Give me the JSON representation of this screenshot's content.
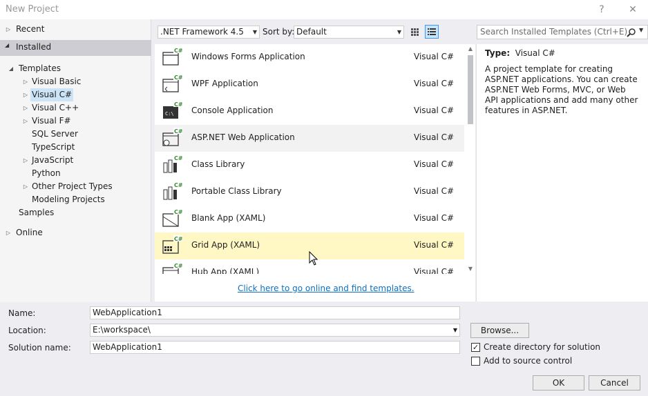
{
  "window": {
    "title": "New Project",
    "help_glyph": "?",
    "close_glyph": "✕"
  },
  "nav": {
    "recent": "Recent",
    "installed": "Installed",
    "templates": "Templates",
    "items": [
      {
        "label": "Visual Basic",
        "expandable": true
      },
      {
        "label": "Visual C#",
        "expandable": true,
        "selected": true
      },
      {
        "label": "Visual C++",
        "expandable": true
      },
      {
        "label": "Visual F#",
        "expandable": true
      },
      {
        "label": "SQL Server",
        "expandable": false
      },
      {
        "label": "TypeScript",
        "expandable": false
      },
      {
        "label": "JavaScript",
        "expandable": true
      },
      {
        "label": "Python",
        "expandable": false
      },
      {
        "label": "Other Project Types",
        "expandable": true
      },
      {
        "label": "Modeling Projects",
        "expandable": false
      }
    ],
    "samples": "Samples",
    "online": "Online"
  },
  "toolbar": {
    "framework": ".NET Framework 4.5",
    "sort_label": "Sort by:",
    "sort_value": "Default",
    "search_placeholder": "Search Installed Templates (Ctrl+E)"
  },
  "templates": [
    {
      "name": "Windows Forms Application",
      "lang": "Visual C#",
      "icon": "winforms-icon"
    },
    {
      "name": "WPF Application",
      "lang": "Visual C#",
      "icon": "wpf-icon"
    },
    {
      "name": "Console Application",
      "lang": "Visual C#",
      "icon": "console-icon"
    },
    {
      "name": "ASP.NET Web Application",
      "lang": "Visual C#",
      "icon": "web-app-icon",
      "state": "hover"
    },
    {
      "name": "Class Library",
      "lang": "Visual C#",
      "icon": "class-library-icon"
    },
    {
      "name": "Portable Class Library",
      "lang": "Visual C#",
      "icon": "portable-library-icon"
    },
    {
      "name": "Blank App (XAML)",
      "lang": "Visual C#",
      "icon": "blank-app-icon"
    },
    {
      "name": "Grid App (XAML)",
      "lang": "Visual C#",
      "icon": "grid-app-icon",
      "state": "selected"
    },
    {
      "name": "Hub App (XAML)",
      "lang": "Visual C#",
      "icon": "hub-app-icon"
    }
  ],
  "online_link": "Click here to go online and find templates.",
  "details": {
    "type_label": "Type:",
    "type_value": "Visual C#",
    "description": "A project template for creating ASP.NET applications. You can create ASP.NET Web Forms, MVC,  or Web API applications and add many other features in ASP.NET."
  },
  "form": {
    "name_label": "Name:",
    "name_value": "WebApplication1",
    "location_label": "Location:",
    "location_value": "E:\\workspace\\",
    "solution_label": "Solution name:",
    "solution_value": "WebApplication1",
    "browse": "Browse...",
    "create_dir": "Create directory for solution",
    "create_dir_checked": true,
    "source_control": "Add to source control",
    "source_control_checked": false,
    "ok": "OK",
    "cancel": "Cancel"
  },
  "colors": {
    "accent": "#3399ff",
    "selected_row": "#fff8c5",
    "link": "#0e70c0",
    "csharp_badge": "#388a34"
  }
}
